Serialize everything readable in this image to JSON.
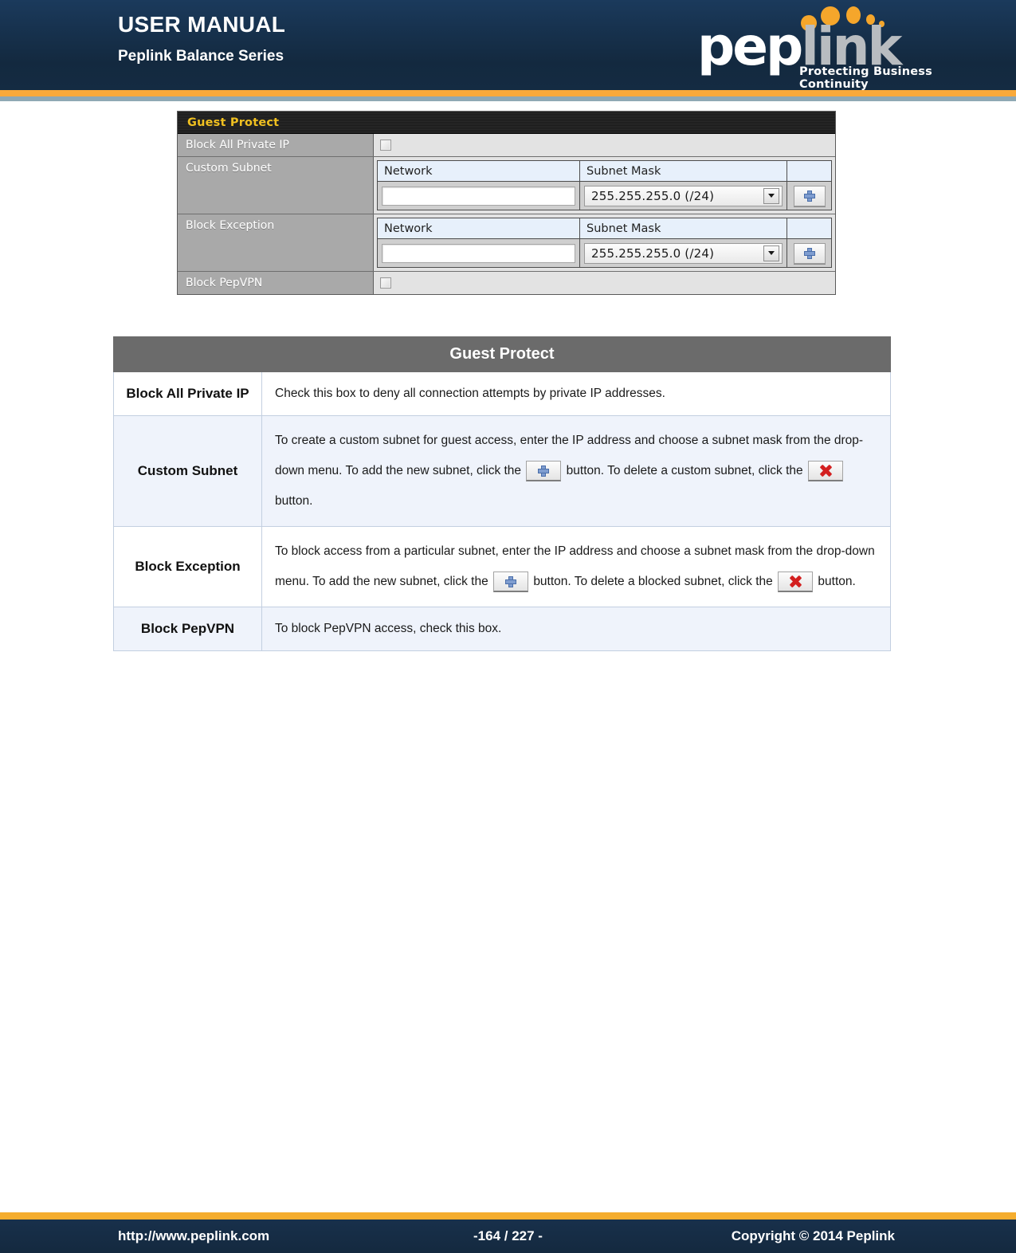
{
  "header": {
    "title": "USER MANUAL",
    "subtitle": "Peplink Balance Series",
    "logo": {
      "word_primary": "pep",
      "word_secondary": "link",
      "tagline": "Protecting Business Continuity"
    }
  },
  "screenshot": {
    "panel_title": "Guest Protect",
    "rows": {
      "block_all_private_ip": {
        "label": "Block All Private IP",
        "checkbox_checked": false
      },
      "custom_subnet": {
        "label": "Custom Subnet",
        "col_network": "Network",
        "col_subnet_mask": "Subnet Mask",
        "network_value": "",
        "subnet_mask_value": "255.255.255.0 (/24)",
        "add_button": "add-row"
      },
      "block_exception": {
        "label": "Block Exception",
        "col_network": "Network",
        "col_subnet_mask": "Subnet Mask",
        "network_value": "",
        "subnet_mask_value": "255.255.255.0 (/24)",
        "add_button": "add-row"
      },
      "block_pepvpn": {
        "label": "Block PepVPN",
        "checkbox_checked": false
      }
    }
  },
  "description_table": {
    "title": "Guest Protect",
    "rows": [
      {
        "key": "Block All Private IP",
        "text": "Check this box to deny all connection attempts by private IP addresses."
      },
      {
        "key": "Custom Subnet",
        "seg1": "To create a custom subnet for guest access, enter the IP address and choose a subnet mask from the drop-down menu. To add the new subnet, click the",
        "seg2": "button. To delete a custom subnet, click the",
        "seg3": "button."
      },
      {
        "key": "Block Exception",
        "seg1": "To block access from a particular subnet, enter the IP address and choose a subnet mask from the drop-down menu. To add the new subnet, click the",
        "seg2": "button. To delete a blocked subnet, click the",
        "seg3": "button."
      },
      {
        "key": "Block PepVPN",
        "text": "To block PepVPN access, check this box."
      }
    ]
  },
  "footer": {
    "url": "http://www.peplink.com",
    "page": "-164 / 227 -",
    "copyright": "Copyright © 2014 Peplink"
  },
  "colors": {
    "header_bg": "#16304b",
    "accent_orange": "#f9a93a",
    "accent_blue_rule": "#8fa8b4",
    "table_header_gray": "#6b6b6b",
    "row_alt_blue": "#eff3fb",
    "panel_title_gold": "#f0c020",
    "panel_label_gray": "#a9a9a9"
  }
}
